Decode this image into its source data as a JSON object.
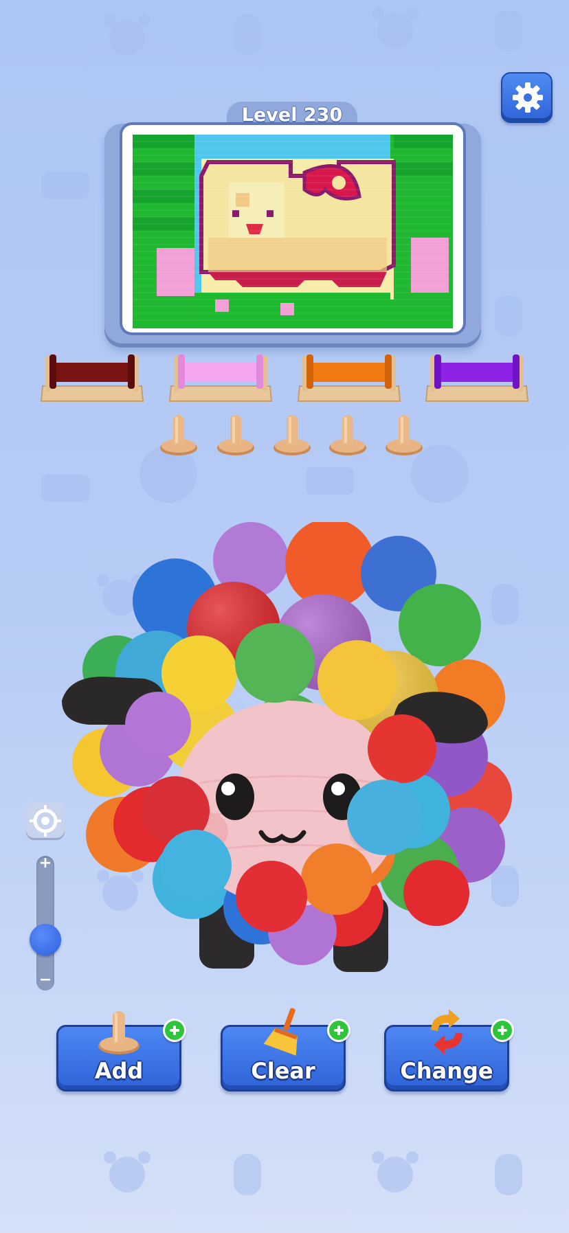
{
  "level": {
    "label": "Level 230"
  },
  "spools": [
    {
      "name": "dark-red-spool",
      "color": "#7a1412"
    },
    {
      "name": "pink-spool",
      "color": "#f4a6ee"
    },
    {
      "name": "orange-spool",
      "color": "#f07a10"
    },
    {
      "name": "purple-spool",
      "color": "#8e23e6"
    }
  ],
  "pegs": {
    "count": 5,
    "color": "#e8b483"
  },
  "zoom": {
    "plus": "+",
    "minus": "−",
    "level": 0.3
  },
  "actions": [
    {
      "label": "Add",
      "icon": "peg-icon"
    },
    {
      "label": "Clear",
      "icon": "broom-icon"
    },
    {
      "label": "Change",
      "icon": "swap-arrows-icon"
    }
  ],
  "palette": [
    "#1db92f",
    "#17a531",
    "#f7e89c",
    "#f1c985",
    "#c91d4b",
    "#8c1a6b",
    "#f2a0d5",
    "#4fc6ee",
    "#e02b44"
  ]
}
